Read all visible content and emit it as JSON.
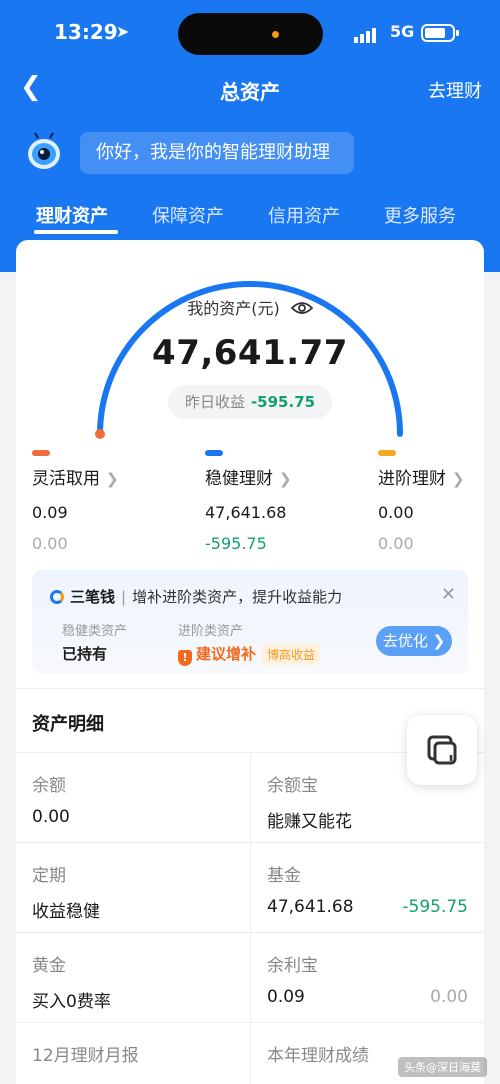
{
  "status_bar": {
    "time": "13:29",
    "network": "5G"
  },
  "nav": {
    "title": "总资产",
    "right_link": "去理财"
  },
  "assistant": {
    "greeting": "你好，我是你的智能理财助理"
  },
  "tabs": [
    {
      "label": "理财资产",
      "active": true
    },
    {
      "label": "保障资产",
      "active": false
    },
    {
      "label": "信用资产",
      "active": false
    },
    {
      "label": "更多服务",
      "active": false
    }
  ],
  "summary": {
    "label": "我的资产(元)",
    "total": "47,641.77",
    "yesterday_label": "昨日收益",
    "yesterday_value": "-595.75"
  },
  "categories": [
    {
      "name": "灵活取用",
      "value": "0.09",
      "change": "0.00",
      "color": "#f26b3a"
    },
    {
      "name": "稳健理财",
      "value": "47,641.68",
      "change": "-595.75",
      "color": "#1a77f2"
    },
    {
      "name": "进阶理财",
      "value": "0.00",
      "change": "0.00",
      "color": "#f5a623"
    }
  ],
  "promo": {
    "brand": "三笔钱",
    "text": "增补进阶类资产，提升收益能力",
    "seg1_label": "稳健类资产",
    "seg1_value": "已持有",
    "seg2_label": "进阶类资产",
    "seg2_value": "建议增补",
    "seg2_tag": "博高收益",
    "button": "去优化"
  },
  "detail": {
    "title": "资产明细",
    "items": [
      {
        "label": "余额",
        "value": "0.00",
        "change": ""
      },
      {
        "label": "余额宝",
        "value": "能赚又能花",
        "change": ""
      },
      {
        "label": "定期",
        "value": "收益稳健",
        "change": ""
      },
      {
        "label": "基金",
        "value": "47,641.68",
        "change": "-595.75"
      },
      {
        "label": "黄金",
        "value": "买入0费率",
        "change": ""
      },
      {
        "label": "余利宝",
        "value": "0.09",
        "change": "0.00"
      },
      {
        "label": "12月理财月报",
        "value": "",
        "change": ""
      },
      {
        "label": "本年理财成绩",
        "value": "",
        "change": ""
      }
    ]
  },
  "watermark": "头条@深日海莫"
}
